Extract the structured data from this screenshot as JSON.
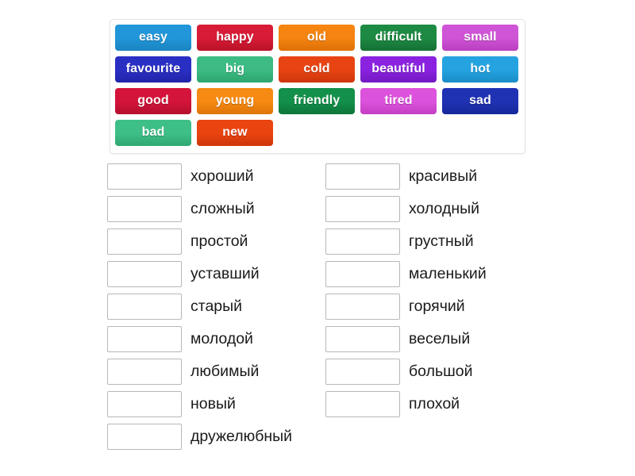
{
  "tile_bank": {
    "name": "word-tile-bank",
    "tiles": [
      {
        "label": "easy",
        "color": "#2196d9",
        "color_dark": "#1b86c4"
      },
      {
        "label": "happy",
        "color": "#d81b36",
        "color_dark": "#bc1329"
      },
      {
        "label": "old",
        "color": "#f58410",
        "color_dark": "#e07207"
      },
      {
        "label": "difficult",
        "color": "#1d8a43",
        "color_dark": "#167337"
      },
      {
        "label": "small",
        "color": "#cf54d6",
        "color_dark": "#bb42c2"
      },
      {
        "label": "favourite",
        "color": "#2a2fc4",
        "color_dark": "#2125ab"
      },
      {
        "label": "big",
        "color": "#3cbc84",
        "color_dark": "#2fa771"
      },
      {
        "label": "cold",
        "color": "#e84413",
        "color_dark": "#cf370c"
      },
      {
        "label": "beautiful",
        "color": "#8a22e0",
        "color_dark": "#761ac4"
      },
      {
        "label": "hot",
        "color": "#24a3e0",
        "color_dark": "#1b8fc9"
      },
      {
        "label": "good",
        "color": "#d4143a",
        "color_dark": "#b8102f"
      },
      {
        "label": "young",
        "color": "#f68a12",
        "color_dark": "#e07709"
      },
      {
        "label": "friendly",
        "color": "#13904a",
        "color_dark": "#0e783c"
      },
      {
        "label": "tired",
        "color": "#dc52dc",
        "color_dark": "#c640c6"
      },
      {
        "label": "sad",
        "color": "#1f32b4",
        "color_dark": "#18299c"
      },
      {
        "label": "bad",
        "color": "#3fbf88",
        "color_dark": "#31aa74"
      },
      {
        "label": "new",
        "color": "#ea4411",
        "color_dark": "#d0370a"
      }
    ]
  },
  "answers": {
    "left_column": [
      {
        "box_value": "",
        "label": "хороший"
      },
      {
        "box_value": "",
        "label": "сложный"
      },
      {
        "box_value": "",
        "label": "простой"
      },
      {
        "box_value": "",
        "label": "уставший"
      },
      {
        "box_value": "",
        "label": "старый"
      },
      {
        "box_value": "",
        "label": "молодой"
      },
      {
        "box_value": "",
        "label": "любимый"
      },
      {
        "box_value": "",
        "label": "новый"
      },
      {
        "box_value": "",
        "label": "дружелюбный"
      }
    ],
    "right_column": [
      {
        "box_value": "",
        "label": "красивый"
      },
      {
        "box_value": "",
        "label": "холодный"
      },
      {
        "box_value": "",
        "label": "грустный"
      },
      {
        "box_value": "",
        "label": "маленький"
      },
      {
        "box_value": "",
        "label": "горячий"
      },
      {
        "box_value": "",
        "label": "веселый"
      },
      {
        "box_value": "",
        "label": "большой"
      },
      {
        "box_value": "",
        "label": "плохой"
      }
    ]
  },
  "colors": {
    "page_background": "#ffffff",
    "bank_border": "#e3e3e3",
    "drop_box_border": "#b8b8b8",
    "label_text": "#1a1a1a",
    "tile_text": "#ffffff"
  }
}
